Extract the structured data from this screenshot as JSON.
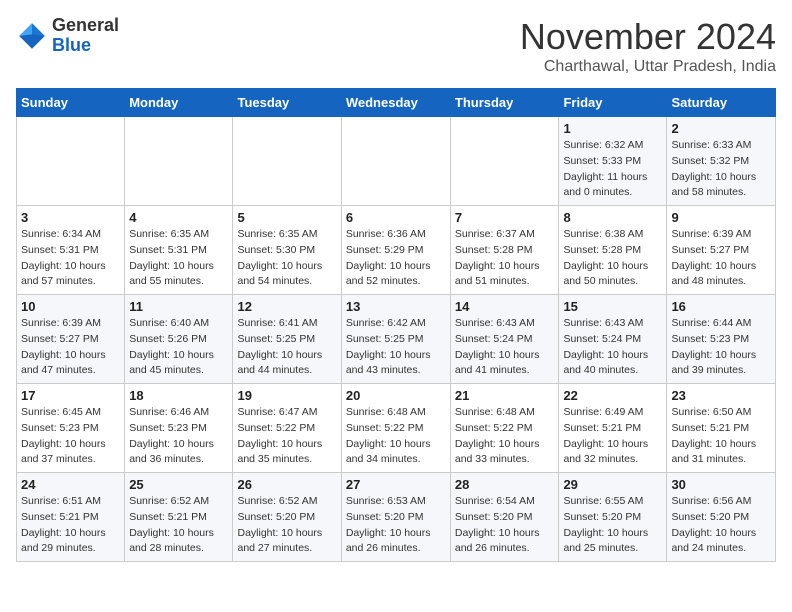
{
  "header": {
    "logo_general": "General",
    "logo_blue": "Blue",
    "month_title": "November 2024",
    "subtitle": "Charthawal, Uttar Pradesh, India"
  },
  "weekdays": [
    "Sunday",
    "Monday",
    "Tuesday",
    "Wednesday",
    "Thursday",
    "Friday",
    "Saturday"
  ],
  "weeks": [
    [
      {
        "day": "",
        "info": ""
      },
      {
        "day": "",
        "info": ""
      },
      {
        "day": "",
        "info": ""
      },
      {
        "day": "",
        "info": ""
      },
      {
        "day": "",
        "info": ""
      },
      {
        "day": "1",
        "info": "Sunrise: 6:32 AM\nSunset: 5:33 PM\nDaylight: 11 hours and 0 minutes."
      },
      {
        "day": "2",
        "info": "Sunrise: 6:33 AM\nSunset: 5:32 PM\nDaylight: 10 hours and 58 minutes."
      }
    ],
    [
      {
        "day": "3",
        "info": "Sunrise: 6:34 AM\nSunset: 5:31 PM\nDaylight: 10 hours and 57 minutes."
      },
      {
        "day": "4",
        "info": "Sunrise: 6:35 AM\nSunset: 5:31 PM\nDaylight: 10 hours and 55 minutes."
      },
      {
        "day": "5",
        "info": "Sunrise: 6:35 AM\nSunset: 5:30 PM\nDaylight: 10 hours and 54 minutes."
      },
      {
        "day": "6",
        "info": "Sunrise: 6:36 AM\nSunset: 5:29 PM\nDaylight: 10 hours and 52 minutes."
      },
      {
        "day": "7",
        "info": "Sunrise: 6:37 AM\nSunset: 5:28 PM\nDaylight: 10 hours and 51 minutes."
      },
      {
        "day": "8",
        "info": "Sunrise: 6:38 AM\nSunset: 5:28 PM\nDaylight: 10 hours and 50 minutes."
      },
      {
        "day": "9",
        "info": "Sunrise: 6:39 AM\nSunset: 5:27 PM\nDaylight: 10 hours and 48 minutes."
      }
    ],
    [
      {
        "day": "10",
        "info": "Sunrise: 6:39 AM\nSunset: 5:27 PM\nDaylight: 10 hours and 47 minutes."
      },
      {
        "day": "11",
        "info": "Sunrise: 6:40 AM\nSunset: 5:26 PM\nDaylight: 10 hours and 45 minutes."
      },
      {
        "day": "12",
        "info": "Sunrise: 6:41 AM\nSunset: 5:25 PM\nDaylight: 10 hours and 44 minutes."
      },
      {
        "day": "13",
        "info": "Sunrise: 6:42 AM\nSunset: 5:25 PM\nDaylight: 10 hours and 43 minutes."
      },
      {
        "day": "14",
        "info": "Sunrise: 6:43 AM\nSunset: 5:24 PM\nDaylight: 10 hours and 41 minutes."
      },
      {
        "day": "15",
        "info": "Sunrise: 6:43 AM\nSunset: 5:24 PM\nDaylight: 10 hours and 40 minutes."
      },
      {
        "day": "16",
        "info": "Sunrise: 6:44 AM\nSunset: 5:23 PM\nDaylight: 10 hours and 39 minutes."
      }
    ],
    [
      {
        "day": "17",
        "info": "Sunrise: 6:45 AM\nSunset: 5:23 PM\nDaylight: 10 hours and 37 minutes."
      },
      {
        "day": "18",
        "info": "Sunrise: 6:46 AM\nSunset: 5:23 PM\nDaylight: 10 hours and 36 minutes."
      },
      {
        "day": "19",
        "info": "Sunrise: 6:47 AM\nSunset: 5:22 PM\nDaylight: 10 hours and 35 minutes."
      },
      {
        "day": "20",
        "info": "Sunrise: 6:48 AM\nSunset: 5:22 PM\nDaylight: 10 hours and 34 minutes."
      },
      {
        "day": "21",
        "info": "Sunrise: 6:48 AM\nSunset: 5:22 PM\nDaylight: 10 hours and 33 minutes."
      },
      {
        "day": "22",
        "info": "Sunrise: 6:49 AM\nSunset: 5:21 PM\nDaylight: 10 hours and 32 minutes."
      },
      {
        "day": "23",
        "info": "Sunrise: 6:50 AM\nSunset: 5:21 PM\nDaylight: 10 hours and 31 minutes."
      }
    ],
    [
      {
        "day": "24",
        "info": "Sunrise: 6:51 AM\nSunset: 5:21 PM\nDaylight: 10 hours and 29 minutes."
      },
      {
        "day": "25",
        "info": "Sunrise: 6:52 AM\nSunset: 5:21 PM\nDaylight: 10 hours and 28 minutes."
      },
      {
        "day": "26",
        "info": "Sunrise: 6:52 AM\nSunset: 5:20 PM\nDaylight: 10 hours and 27 minutes."
      },
      {
        "day": "27",
        "info": "Sunrise: 6:53 AM\nSunset: 5:20 PM\nDaylight: 10 hours and 26 minutes."
      },
      {
        "day": "28",
        "info": "Sunrise: 6:54 AM\nSunset: 5:20 PM\nDaylight: 10 hours and 26 minutes."
      },
      {
        "day": "29",
        "info": "Sunrise: 6:55 AM\nSunset: 5:20 PM\nDaylight: 10 hours and 25 minutes."
      },
      {
        "day": "30",
        "info": "Sunrise: 6:56 AM\nSunset: 5:20 PM\nDaylight: 10 hours and 24 minutes."
      }
    ]
  ]
}
